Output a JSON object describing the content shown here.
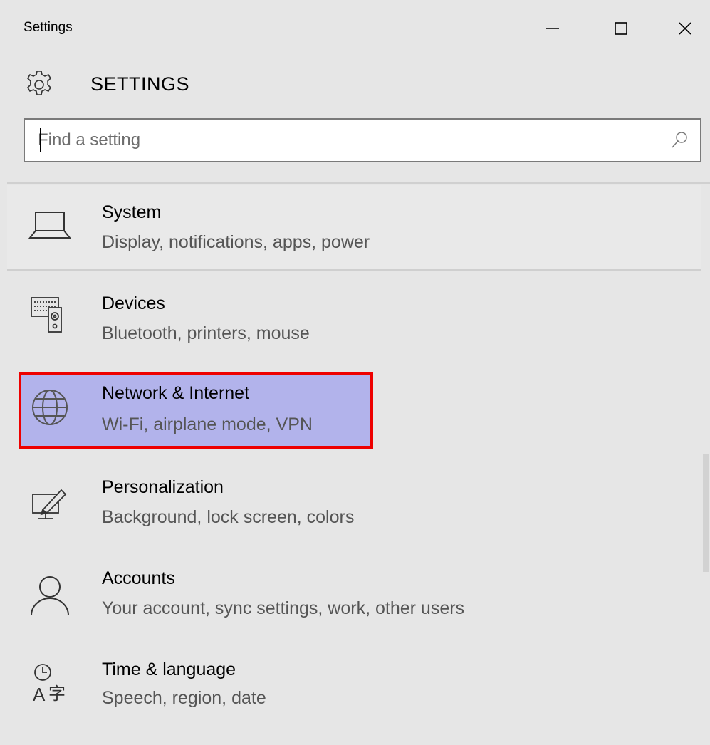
{
  "window": {
    "title": "Settings",
    "controls": {
      "minimize_icon": "minimize-icon",
      "maximize_icon": "maximize-icon",
      "close_icon": "close-icon"
    }
  },
  "header": {
    "icon": "gear-icon",
    "title": "SETTINGS"
  },
  "search": {
    "placeholder": "Find a setting",
    "value": "",
    "icon": "search-icon"
  },
  "categories": [
    {
      "icon": "laptop-icon",
      "title": "System",
      "subtitle": "Display, notifications, apps, power"
    },
    {
      "icon": "devices-icon",
      "title": "Devices",
      "subtitle": "Bluetooth, printers, mouse"
    },
    {
      "icon": "globe-icon",
      "title": "Network & Internet",
      "subtitle": "Wi-Fi, airplane mode, VPN",
      "highlighted": true
    },
    {
      "icon": "personalization-icon",
      "title": "Personalization",
      "subtitle": "Background, lock screen, colors"
    },
    {
      "icon": "person-icon",
      "title": "Accounts",
      "subtitle": "Your account, sync settings, work, other users"
    },
    {
      "icon": "time-language-icon",
      "title": "Time & language",
      "subtitle": "Speech, region, date"
    }
  ],
  "colors": {
    "background": "#e6e6e6",
    "highlight_fill": "#b2b3eb",
    "highlight_border": "#ee0000",
    "subtitle_text": "#555555"
  }
}
